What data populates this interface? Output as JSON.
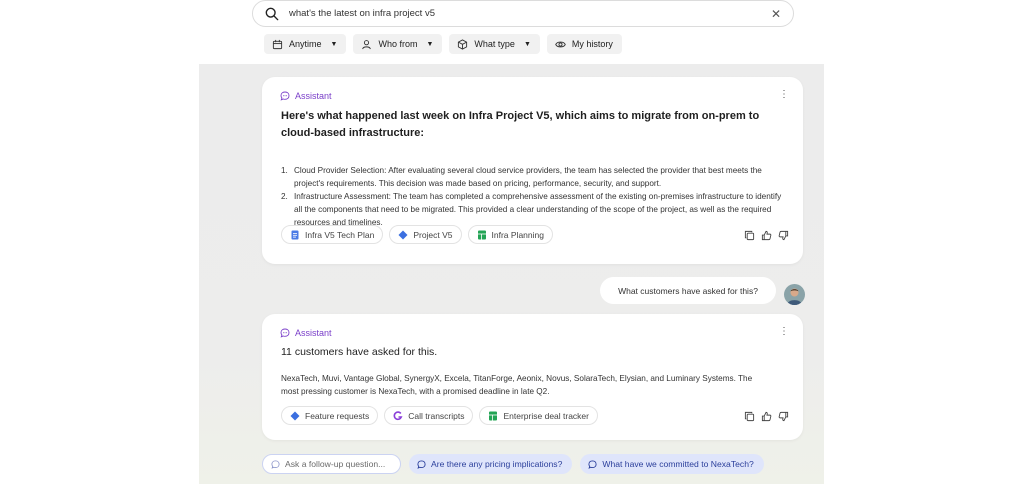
{
  "search": {
    "query": "what's the latest on infra project v5",
    "clear_icon": "close-icon"
  },
  "filters": [
    {
      "label": "Anytime",
      "icon": "calendar-icon",
      "dropdown": true
    },
    {
      "label": "Who from",
      "icon": "person-icon",
      "dropdown": true
    },
    {
      "label": "What type",
      "icon": "cube-icon",
      "dropdown": true
    },
    {
      "label": "My history",
      "icon": "eye-icon",
      "dropdown": false
    }
  ],
  "messages": {
    "assistant_label": "Assistant",
    "first": {
      "headline": "Here's what happened last week on Infra Project V5, which aims to migrate from on-prem to cloud-based infrastructure:",
      "items": [
        {
          "num": "1.",
          "text": "Cloud Provider Selection: After evaluating several cloud service providers, the team has selected the provider that best meets the project's requirements. This decision was made based on pricing, performance, security, and support."
        },
        {
          "num": "2.",
          "text": "Infrastructure Assessment: The team has completed a comprehensive assessment of the existing on-premises infrastructure to identify all the components that need to be migrated. This provided a clear understanding of the scope of the project, as well as the required resources and timelines."
        }
      ],
      "sources": [
        {
          "label": "Infra V5 Tech Plan",
          "icon": "doc-icon",
          "color": "#4a7be6"
        },
        {
          "label": "Project V5",
          "icon": "diamond-icon",
          "color": "#3b6fe0"
        },
        {
          "label": "Infra Planning",
          "icon": "sheet-icon",
          "color": "#23a455"
        }
      ]
    },
    "user": {
      "text": "What customers have asked for this?"
    },
    "second": {
      "headline": "11 customers have asked for this.",
      "body": "NexaTech, Muvi, Vantage Global, SynergyX, Excela, TitanForge, Aeonix, Novus, SolaraTech, Elysian, and Luminary Systems. The most pressing customer is NexaTech, with a promised deadline in late Q2.",
      "sources": [
        {
          "label": "Feature requests",
          "icon": "diamond-icon",
          "color": "#3b6fe0"
        },
        {
          "label": "Call transcripts",
          "icon": "gong-icon",
          "color": "#8a3fd9"
        },
        {
          "label": "Enterprise deal tracker",
          "icon": "sheet-icon",
          "color": "#23a455"
        }
      ]
    }
  },
  "followups": {
    "placeholder": "Ask a follow-up question...",
    "suggestions": [
      "Are there any pricing implications?",
      "What have we committed to NexaTech?"
    ]
  },
  "colors": {
    "assistant_accent": "#7a3fc9",
    "suggestion_bg": "#dfe5fb",
    "suggestion_text": "#2b3f9b"
  }
}
